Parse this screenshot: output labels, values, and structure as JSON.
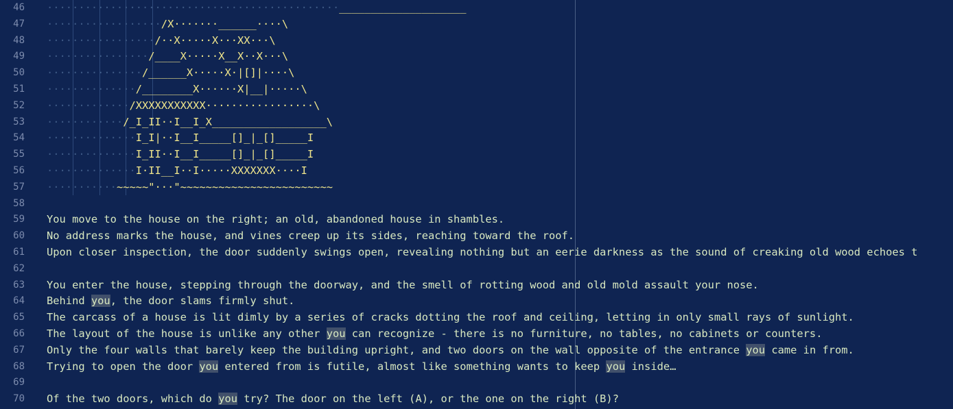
{
  "editor": {
    "lines": [
      {
        "n": "46",
        "dots": "··············································",
        "art": "____________________",
        "text": ""
      },
      {
        "n": "47",
        "dots": "··················",
        "art": "/X·······______····\\",
        "text": ""
      },
      {
        "n": "48",
        "dots": "·················",
        "art": "/··X·····X···XX···\\",
        "text": ""
      },
      {
        "n": "49",
        "dots": "················",
        "art": "/____X·····X__X··X···\\",
        "text": ""
      },
      {
        "n": "50",
        "dots": "···············",
        "art": "/______X·····X·|[]|····\\",
        "text": ""
      },
      {
        "n": "51",
        "dots": "··············",
        "art": "/________X······X|__|·····\\",
        "text": ""
      },
      {
        "n": "52",
        "dots": "·············",
        "art": "/XXXXXXXXXXX·················\\",
        "text": ""
      },
      {
        "n": "53",
        "dots": "············",
        "art": "/_I_II··I__I_X__________________\\",
        "text": ""
      },
      {
        "n": "54",
        "dots": "··············",
        "art": "I_I|··I__I_____[]_|_[]_____I",
        "text": ""
      },
      {
        "n": "55",
        "dots": "··············",
        "art": "I_II··I__I_____[]_|_[]_____I",
        "text": ""
      },
      {
        "n": "56",
        "dots": "··············",
        "art": "I·II__I··I·····XXXXXXX····I",
        "text": ""
      },
      {
        "n": "57",
        "dots": "···········",
        "art": "~~~~~\"···\"~~~~~~~~~~~~~~~~~~~~~~~~",
        "text": ""
      },
      {
        "n": "58",
        "dots": "",
        "art": "",
        "text": ""
      },
      {
        "n": "59",
        "dots": "",
        "art": "",
        "text": "You move to the house on the right; an old, abandoned house in shambles."
      },
      {
        "n": "60",
        "dots": "",
        "art": "",
        "text": "No address marks the house, and vines creep up its sides, reaching toward the roof."
      },
      {
        "n": "61",
        "dots": "",
        "art": "",
        "text": "Upon closer inspection, the door suddenly swings open, revealing nothing but an eerie darkness as the sound of creaking old wood echoes t"
      },
      {
        "n": "62",
        "dots": "",
        "art": "",
        "text": ""
      },
      {
        "n": "63",
        "dots": "",
        "art": "",
        "text": "You enter the house, stepping through the doorway, and the smell of rotting wood and old mold assault your nose."
      },
      {
        "n": "64",
        "dots": "",
        "art": "",
        "text": "Behind you, the door slams firmly shut."
      },
      {
        "n": "65",
        "dots": "",
        "art": "",
        "text": "The carcass of a house is lit dimly by a series of cracks dotting the roof and ceiling, letting in only small rays of sunlight."
      },
      {
        "n": "66",
        "dots": "",
        "art": "",
        "text": "The layout of the house is unlike any other you can recognize - there is no furniture, no tables, no cabinets or counters."
      },
      {
        "n": "67",
        "dots": "",
        "art": "",
        "text": "Only the four walls that barely keep the building upright, and two doors on the wall opposite of the entrance you came in from."
      },
      {
        "n": "68",
        "dots": "",
        "art": "",
        "text": "Trying to open the door you entered from is futile, almost like something wants to keep you inside…"
      },
      {
        "n": "69",
        "dots": "",
        "art": "",
        "text": ""
      },
      {
        "n": "70",
        "dots": "",
        "art": "",
        "text": "Of the two doors, which do you try? The door on the left (A), or the one on the right (B)?"
      }
    ],
    "highlight_word": "you",
    "colors": {
      "background": "#0f2452",
      "text": "#d8e8c0",
      "art": "#f0e68c",
      "line_number": "#7c8bad",
      "highlight": "#41506b"
    }
  }
}
